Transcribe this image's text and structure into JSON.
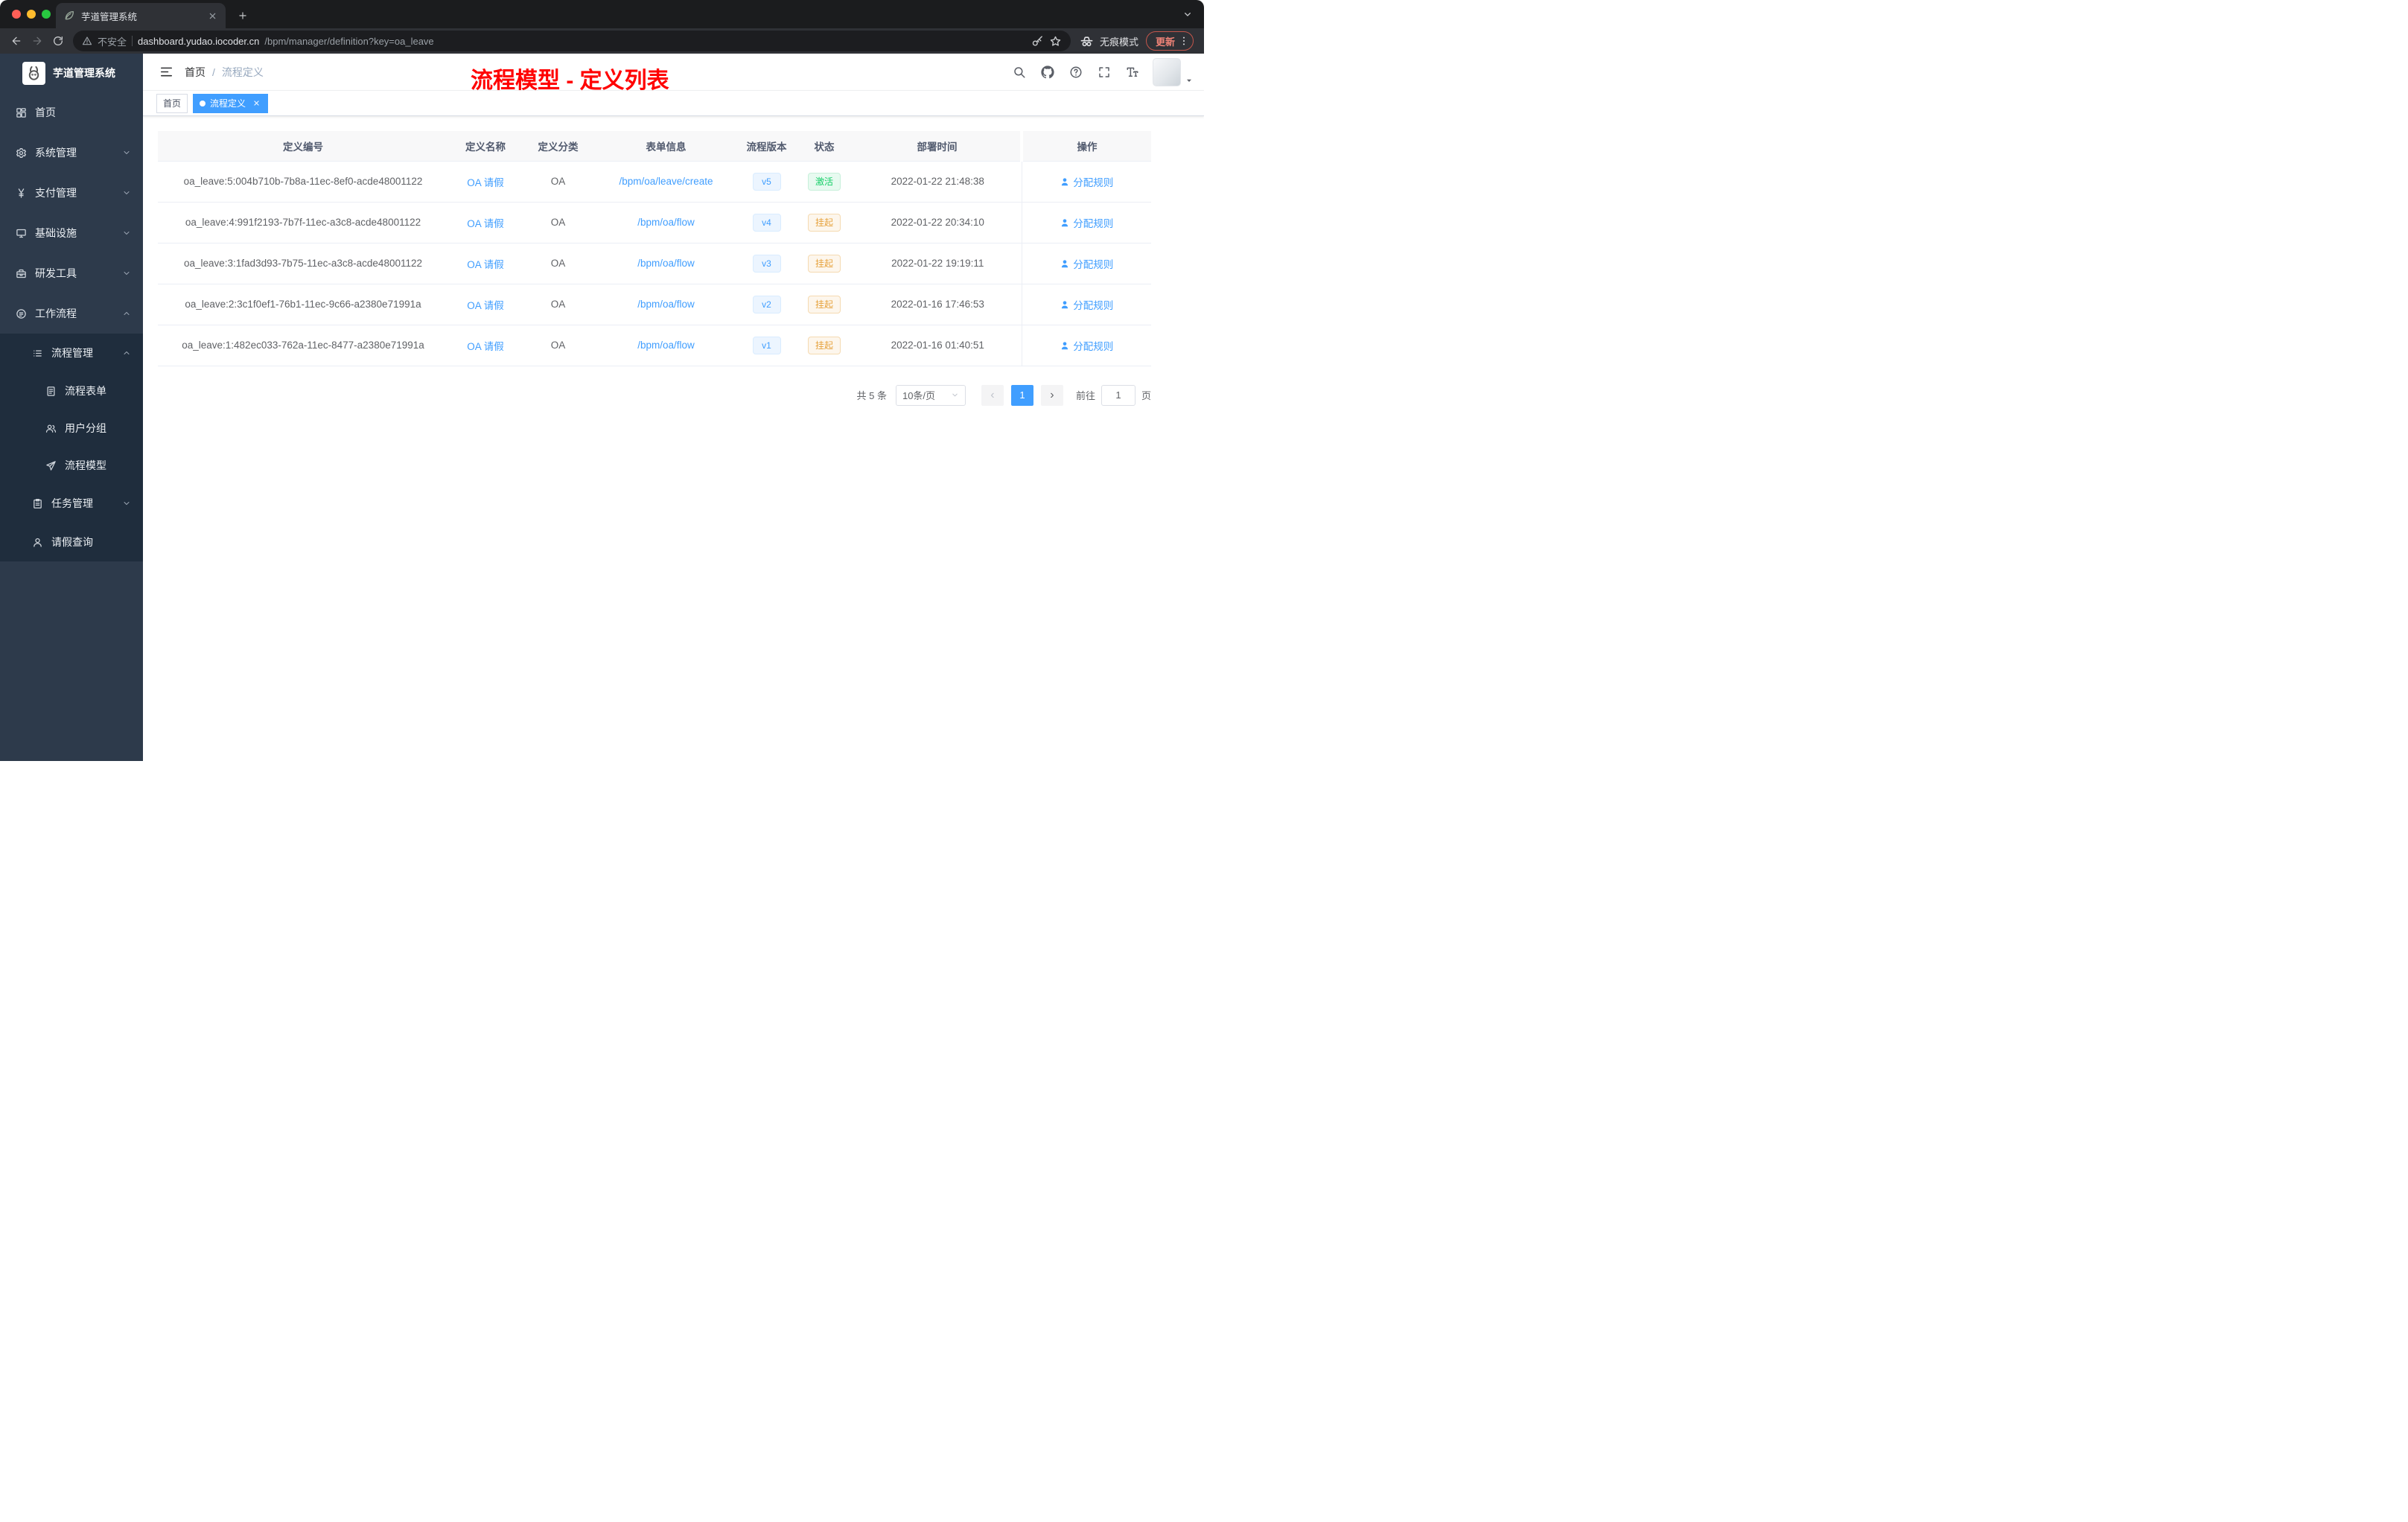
{
  "browser": {
    "tab": {
      "title": "芋道管理系统"
    },
    "address": {
      "security_label": "不安全",
      "host": "dashboard.yudao.iocoder.cn",
      "path": "/bpm/manager/definition?key=oa_leave"
    },
    "incognito_label": "无痕模式",
    "update_label": "更新"
  },
  "sidebar": {
    "logo_title": "芋道管理系统",
    "menu": [
      {
        "key": "home",
        "label": "首页",
        "icon": "dashboard-icon",
        "level": 1
      },
      {
        "key": "system-management",
        "label": "系统管理",
        "icon": "gear-icon",
        "level": 1,
        "arrow": "down"
      },
      {
        "key": "payment-management",
        "label": "支付管理",
        "icon": "yen-icon",
        "level": 1,
        "arrow": "down"
      },
      {
        "key": "infrastructure",
        "label": "基础设施",
        "icon": "monitor-icon",
        "level": 1,
        "arrow": "down"
      },
      {
        "key": "dev-tools",
        "label": "研发工具",
        "icon": "toolbox-icon",
        "level": 1,
        "arrow": "down"
      },
      {
        "key": "workflow",
        "label": "工作流程",
        "icon": "workflow-icon",
        "level": 1,
        "arrow": "up"
      },
      {
        "key": "process-management",
        "label": "流程管理",
        "icon": "list-icon",
        "level": 2,
        "arrow": "up"
      },
      {
        "key": "process-form",
        "label": "流程表单",
        "icon": "document-icon",
        "level": 3
      },
      {
        "key": "user-group",
        "label": "用户分组",
        "icon": "users-icon",
        "level": 3
      },
      {
        "key": "process-model",
        "label": "流程模型",
        "icon": "paper-plane-icon",
        "level": 3
      },
      {
        "key": "task-management",
        "label": "任务管理",
        "icon": "clipboard-icon",
        "level": 2,
        "arrow": "down"
      },
      {
        "key": "leave-query",
        "label": "请假查询",
        "icon": "person-icon",
        "level": 2
      }
    ]
  },
  "navbar": {
    "breadcrumb": {
      "home": "首页",
      "separator": "/",
      "current": "流程定义"
    }
  },
  "annotation": {
    "text": "流程模型 - 定义列表",
    "color": "#ff0000"
  },
  "tags": [
    {
      "label": "首页",
      "active": false
    },
    {
      "label": "流程定义",
      "active": true
    }
  ],
  "table": {
    "columns": [
      "定义编号",
      "定义名称",
      "定义分类",
      "表单信息",
      "流程版本",
      "状态",
      "部署时间",
      "操作"
    ],
    "rows": [
      {
        "id": "oa_leave:5:004b710b-7b8a-11ec-8ef0-acde48001122",
        "name": "OA 请假",
        "category": "OA",
        "form": "/bpm/oa/leave/create",
        "version": "v5",
        "status": "激活",
        "status_type": "success",
        "time": "2022-01-22 21:48:38",
        "action": "分配规则"
      },
      {
        "id": "oa_leave:4:991f2193-7b7f-11ec-a3c8-acde48001122",
        "name": "OA 请假",
        "category": "OA",
        "form": "/bpm/oa/flow",
        "version": "v4",
        "status": "挂起",
        "status_type": "warning",
        "time": "2022-01-22 20:34:10",
        "action": "分配规则"
      },
      {
        "id": "oa_leave:3:1fad3d93-7b75-11ec-a3c8-acde48001122",
        "name": "OA 请假",
        "category": "OA",
        "form": "/bpm/oa/flow",
        "version": "v3",
        "status": "挂起",
        "status_type": "warning",
        "time": "2022-01-22 19:19:11",
        "action": "分配规则"
      },
      {
        "id": "oa_leave:2:3c1f0ef1-76b1-11ec-9c66-a2380e71991a",
        "name": "OA 请假",
        "category": "OA",
        "form": "/bpm/oa/flow",
        "version": "v2",
        "status": "挂起",
        "status_type": "warning",
        "time": "2022-01-16 17:46:53",
        "action": "分配规则"
      },
      {
        "id": "oa_leave:1:482ec033-762a-11ec-8477-a2380e71991a",
        "name": "OA 请假",
        "category": "OA",
        "form": "/bpm/oa/flow",
        "version": "v1",
        "status": "挂起",
        "status_type": "warning",
        "time": "2022-01-16 01:40:51",
        "action": "分配规则"
      }
    ]
  },
  "pagination": {
    "total": "共 5 条",
    "page_size": "10条/页",
    "prev": "‹",
    "page": "1",
    "next": "›",
    "goto_prefix": "前往",
    "goto_value": "1",
    "goto_suffix": "页"
  },
  "colors": {
    "accent": "#409eff",
    "success": "#13ce66",
    "warning": "#e6a23c",
    "annotation_red": "#ff0000",
    "sidebar_bg": "#2d3a4b",
    "submenu_bg": "#1f2d3d"
  }
}
